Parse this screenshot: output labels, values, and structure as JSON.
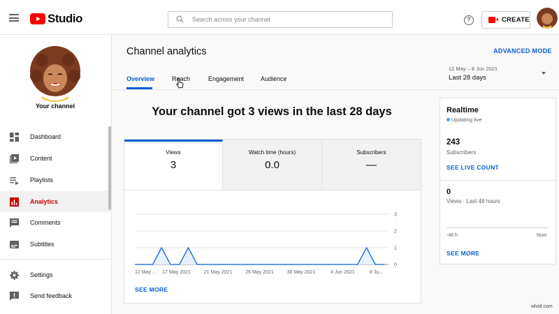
{
  "app": {
    "logo_text": "Studio",
    "watermark": "wlvid.com"
  },
  "search": {
    "placeholder": "Search across your channel"
  },
  "topbar": {
    "help_symbol": "?",
    "create_label": "CREATE"
  },
  "sidebar": {
    "channel_label": "Your channel",
    "items": [
      {
        "label": "Dashboard",
        "icon": "dashboard-icon"
      },
      {
        "label": "Content",
        "icon": "content-icon"
      },
      {
        "label": "Playlists",
        "icon": "playlists-icon"
      },
      {
        "label": "Analytics",
        "icon": "analytics-icon",
        "active": true
      },
      {
        "label": "Comments",
        "icon": "comments-icon"
      },
      {
        "label": "Subtitles",
        "icon": "subtitles-icon"
      },
      {
        "label": "Settings",
        "icon": "settings-icon"
      },
      {
        "label": "Send feedback",
        "icon": "feedback-icon"
      }
    ]
  },
  "header": {
    "title": "Channel analytics",
    "advanced_mode": "ADVANCED MODE",
    "tabs": [
      {
        "label": "Overview",
        "active": true
      },
      {
        "label": "Reach"
      },
      {
        "label": "Engagement"
      },
      {
        "label": "Audience"
      }
    ],
    "date_range": "12 May – 8 Jun 2021",
    "date_label": "Last 28 days"
  },
  "main": {
    "headline": "Your channel got 3 views in the last 28 days",
    "metrics": [
      {
        "label": "Views",
        "value": "3",
        "active": true
      },
      {
        "label": "Watch time (hours)",
        "value": "0.0"
      },
      {
        "label": "Subscribers",
        "value": "—"
      }
    ],
    "see_more": "SEE MORE"
  },
  "chart_data": {
    "type": "area",
    "x_tick_labels": [
      "12 May ...",
      "17 May 2021",
      "21 May 2021",
      "26 May 2021",
      "30 May 2021",
      "4 Jun 2021",
      "8 Ju..."
    ],
    "y_tick_labels": [
      "3",
      "2",
      "1",
      "0"
    ],
    "ylim": [
      0,
      3
    ],
    "days": [
      "12 May",
      "13 May",
      "14 May",
      "15 May",
      "16 May",
      "17 May",
      "18 May",
      "19 May",
      "20 May",
      "21 May",
      "22 May",
      "23 May",
      "24 May",
      "25 May",
      "26 May",
      "27 May",
      "28 May",
      "29 May",
      "30 May",
      "31 May",
      "1 Jun",
      "2 Jun",
      "3 Jun",
      "4 Jun",
      "5 Jun",
      "6 Jun",
      "7 Jun",
      "8 Jun"
    ],
    "values": [
      0,
      0,
      0,
      1,
      0,
      0,
      1,
      0,
      0,
      0,
      0,
      0,
      0,
      0,
      0,
      0,
      0,
      0,
      0,
      0,
      0,
      0,
      0,
      0,
      0,
      0,
      1,
      0,
      0
    ],
    "grid": true,
    "color": "#065fd4"
  },
  "realtime": {
    "title": "Realtime",
    "status": "Updating live",
    "subscribers_value": "243",
    "subscribers_label": "Subscribers",
    "live_count_link": "SEE LIVE COUNT",
    "views_value": "0",
    "views_label": "Views · Last 48 hours",
    "axis_start": "-48 h",
    "axis_end": "Now",
    "see_more": "SEE MORE"
  }
}
